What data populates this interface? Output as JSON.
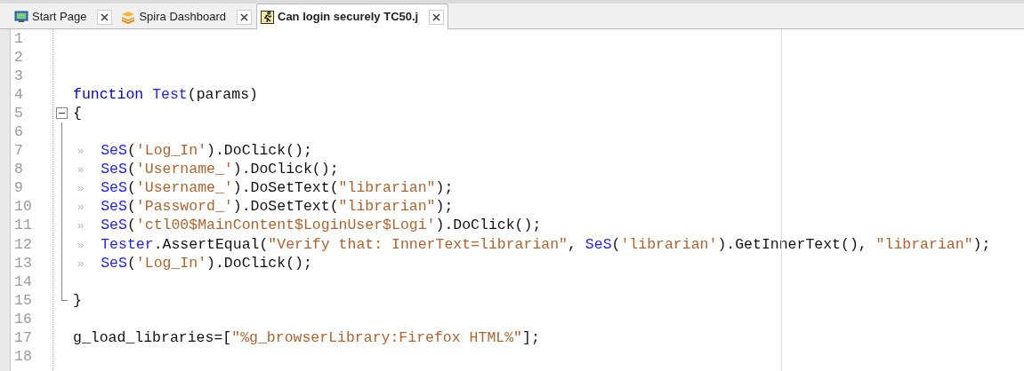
{
  "tabs": [
    {
      "label": "Start Page",
      "selected": false
    },
    {
      "label": "Spira Dashboard",
      "selected": false
    },
    {
      "label": "Can login securely TC50.j",
      "selected": true
    }
  ],
  "editor": {
    "lines": [
      {
        "number": "1"
      },
      {
        "number": "2"
      },
      {
        "number": "3"
      },
      {
        "number": "4",
        "tokens": [
          {
            "kind": "keyword",
            "text": "function "
          },
          {
            "kind": "ident",
            "text": "Test"
          },
          {
            "kind": "plain",
            "text": "(params)"
          }
        ]
      },
      {
        "number": "5",
        "fold_start": true,
        "expanded": true,
        "tokens": [
          {
            "kind": "plain",
            "text": "{"
          }
        ]
      },
      {
        "number": "6",
        "in_fold": true
      },
      {
        "number": "7",
        "in_fold": true,
        "tokens": [
          {
            "kind": "tab",
            "text": "»"
          },
          {
            "kind": "ident",
            "text": "SeS"
          },
          {
            "kind": "plain",
            "text": "("
          },
          {
            "kind": "string",
            "text": "'Log_In'"
          },
          {
            "kind": "plain",
            "text": ").DoClick();"
          }
        ]
      },
      {
        "number": "8",
        "in_fold": true,
        "tokens": [
          {
            "kind": "tab",
            "text": "»"
          },
          {
            "kind": "ident",
            "text": "SeS"
          },
          {
            "kind": "plain",
            "text": "("
          },
          {
            "kind": "string",
            "text": "'Username_'"
          },
          {
            "kind": "plain",
            "text": ").DoClick();"
          }
        ]
      },
      {
        "number": "9",
        "in_fold": true,
        "tokens": [
          {
            "kind": "tab",
            "text": "»"
          },
          {
            "kind": "ident",
            "text": "SeS"
          },
          {
            "kind": "plain",
            "text": "("
          },
          {
            "kind": "string",
            "text": "'Username_'"
          },
          {
            "kind": "plain",
            "text": ").DoSetText("
          },
          {
            "kind": "string",
            "text": "\"librarian\""
          },
          {
            "kind": "plain",
            "text": ");"
          }
        ]
      },
      {
        "number": "10",
        "in_fold": true,
        "tokens": [
          {
            "kind": "tab",
            "text": "»"
          },
          {
            "kind": "ident",
            "text": "SeS"
          },
          {
            "kind": "plain",
            "text": "("
          },
          {
            "kind": "string",
            "text": "'Password_'"
          },
          {
            "kind": "plain",
            "text": ").DoSetText("
          },
          {
            "kind": "string",
            "text": "\"librarian\""
          },
          {
            "kind": "plain",
            "text": ");"
          }
        ]
      },
      {
        "number": "11",
        "in_fold": true,
        "tokens": [
          {
            "kind": "tab",
            "text": "»"
          },
          {
            "kind": "ident",
            "text": "SeS"
          },
          {
            "kind": "plain",
            "text": "("
          },
          {
            "kind": "string",
            "text": "'ctl00$MainContent$LoginUser$Logi'"
          },
          {
            "kind": "plain",
            "text": ").DoClick();"
          }
        ]
      },
      {
        "number": "12",
        "in_fold": true,
        "tokens": [
          {
            "kind": "tab",
            "text": "»"
          },
          {
            "kind": "ident",
            "text": "Tester"
          },
          {
            "kind": "plain",
            "text": ".AssertEqual("
          },
          {
            "kind": "string",
            "text": "\"Verify that: InnerText=librarian\""
          },
          {
            "kind": "plain",
            "text": ", "
          },
          {
            "kind": "ident",
            "text": "SeS"
          },
          {
            "kind": "plain",
            "text": "("
          },
          {
            "kind": "string",
            "text": "'librarian'"
          },
          {
            "kind": "plain",
            "text": ").GetInnerText(), "
          },
          {
            "kind": "string",
            "text": "\"librarian\""
          },
          {
            "kind": "plain",
            "text": ");"
          }
        ]
      },
      {
        "number": "13",
        "in_fold": true,
        "tokens": [
          {
            "kind": "tab",
            "text": "»"
          },
          {
            "kind": "ident",
            "text": "SeS"
          },
          {
            "kind": "plain",
            "text": "("
          },
          {
            "kind": "string",
            "text": "'Log_In'"
          },
          {
            "kind": "plain",
            "text": ").DoClick();"
          }
        ]
      },
      {
        "number": "14",
        "in_fold": true
      },
      {
        "number": "15",
        "fold_end": true,
        "tokens": [
          {
            "kind": "plain",
            "text": "}"
          }
        ]
      },
      {
        "number": "16"
      },
      {
        "number": "17",
        "tokens": [
          {
            "kind": "plain",
            "text": "g_load_libraries=["
          },
          {
            "kind": "string",
            "text": "\"%g_browserLibrary:Firefox HTML%\""
          },
          {
            "kind": "plain",
            "text": "];"
          }
        ]
      },
      {
        "number": "18"
      }
    ]
  }
}
